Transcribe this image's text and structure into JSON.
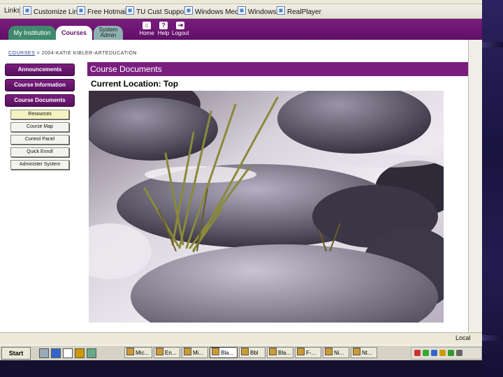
{
  "links_bar": {
    "items": [
      "Links",
      "Customize Links",
      "Free Hotmail",
      "TU Cust Support",
      "Windows Media",
      "Windows",
      "RealPlayer"
    ]
  },
  "header": {
    "tabs": [
      "My Institution",
      "Courses",
      "System Admin"
    ],
    "buttons": [
      {
        "label": "Home",
        "icon": "home-icon"
      },
      {
        "label": "Help",
        "icon": "help-icon"
      },
      {
        "label": "Logout",
        "icon": "logout-icon"
      }
    ],
    "colors": {
      "brand": "#6a1571",
      "accent": "#7a1d7e"
    }
  },
  "breadcrumb": {
    "link": "COURSES",
    "separator": ">",
    "current": "2004-KATIE KIBLER-ARTEDUCATION"
  },
  "nav": {
    "main": [
      "Announcements",
      "Course Information",
      "Course Documents"
    ],
    "sub": [
      "Resources",
      "Course Map",
      "Control Panel",
      "Quick Enroll",
      "Administer System"
    ],
    "selected_sub": "Resources"
  },
  "main": {
    "title": "Course Documents",
    "location": "Current Location: Top"
  },
  "status_bar": {
    "zone": "Local"
  },
  "taskbar": {
    "start": "Start",
    "tasks": [
      "Mic...",
      "En...",
      "Mi...",
      "Bla...",
      "Bbl",
      "Bla...",
      "F-...",
      "Ni...",
      "Nt..."
    ],
    "active_task": "Bla..."
  }
}
